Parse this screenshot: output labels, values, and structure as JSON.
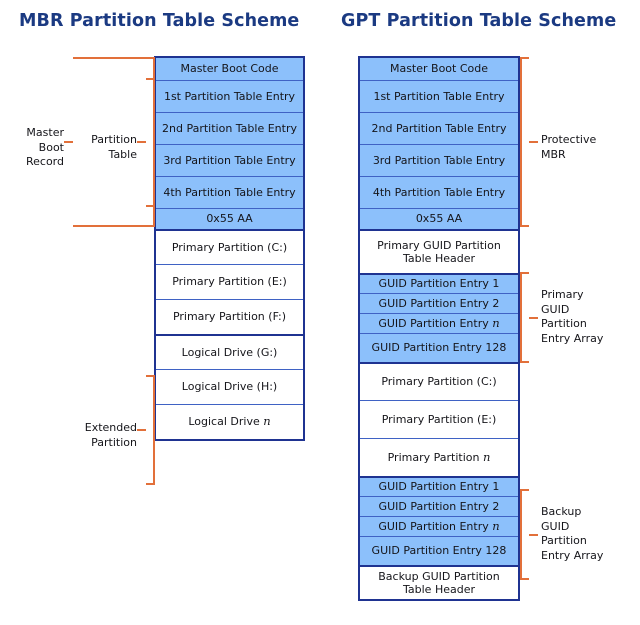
{
  "diagram": {
    "title_left": "MBR Partition Table Scheme",
    "title_right": "GPT Partition Table Scheme",
    "colors": {
      "title": "#1b3a82",
      "table_border": "#1f3391",
      "row_border": "#3f62c4",
      "blue_fill": "#8cc0fb",
      "white_fill": "#ffffff",
      "bracket": "#e2703a",
      "text": "#15151a"
    }
  },
  "mbr": {
    "rows": [
      {
        "label": "Master Boot Code",
        "fill": "blue"
      },
      {
        "label": "1st Partition Table Entry",
        "fill": "blue"
      },
      {
        "label": "2nd Partition Table Entry",
        "fill": "blue"
      },
      {
        "label": "3rd Partition Table Entry",
        "fill": "blue"
      },
      {
        "label": "4th Partition Table Entry",
        "fill": "blue"
      },
      {
        "label": "0x55 AA",
        "fill": "blue"
      },
      {
        "label": "Primary Partition (C:)",
        "fill": "white"
      },
      {
        "label": "Primary Partition (E:)",
        "fill": "white"
      },
      {
        "label": "Primary Partition (F:)",
        "fill": "white"
      },
      {
        "label": "Logical Drive (G:)",
        "fill": "white"
      },
      {
        "label": "Logical Drive (H:)",
        "fill": "white"
      },
      {
        "label": "Logical Drive n",
        "fill": "white",
        "italic_tail": "n"
      }
    ],
    "brackets": [
      {
        "name": "master-boot-record",
        "label": "Master\nBoot\nRecord"
      },
      {
        "name": "partition-table",
        "label": "Partition\nTable"
      },
      {
        "name": "extended-partition",
        "label": "Extended\nPartition"
      }
    ]
  },
  "gpt": {
    "rows": [
      {
        "label": "Master Boot Code",
        "fill": "blue"
      },
      {
        "label": "1st Partition Table Entry",
        "fill": "blue"
      },
      {
        "label": "2nd Partition Table Entry",
        "fill": "blue"
      },
      {
        "label": "3rd Partition Table Entry",
        "fill": "blue"
      },
      {
        "label": "4th Partition Table Entry",
        "fill": "blue"
      },
      {
        "label": "0x55 AA",
        "fill": "blue"
      },
      {
        "label": "Primary GUID Partition Table Header",
        "fill": "white"
      },
      {
        "label": "GUID Partition Entry 1",
        "fill": "blue"
      },
      {
        "label": "GUID Partition Entry 2",
        "fill": "blue"
      },
      {
        "label": "GUID Partition Entry n",
        "fill": "blue",
        "italic_tail": "n"
      },
      {
        "label": "GUID Partition Entry 128",
        "fill": "blue"
      },
      {
        "label": "Primary Partition (C:)",
        "fill": "white"
      },
      {
        "label": "Primary Partition (E:)",
        "fill": "white"
      },
      {
        "label": "Primary Partition n",
        "fill": "white",
        "italic_tail": "n"
      },
      {
        "label": "GUID Partition Entry 1",
        "fill": "blue"
      },
      {
        "label": "GUID Partition Entry 2",
        "fill": "blue"
      },
      {
        "label": "GUID Partition Entry n",
        "fill": "blue",
        "italic_tail": "n"
      },
      {
        "label": "GUID Partition Entry 128",
        "fill": "blue"
      },
      {
        "label": "Backup GUID Partition Table Header",
        "fill": "white"
      }
    ],
    "brackets": [
      {
        "name": "protective-mbr",
        "label": "Protective\nMBR"
      },
      {
        "name": "primary-guid-partition-entry-array",
        "label": "Primary\nGUID\nPartition\nEntry Array"
      },
      {
        "name": "backup-guid-partition-entry-array",
        "label": "Backup\nGUID\nPartition\nEntry Array"
      }
    ]
  }
}
